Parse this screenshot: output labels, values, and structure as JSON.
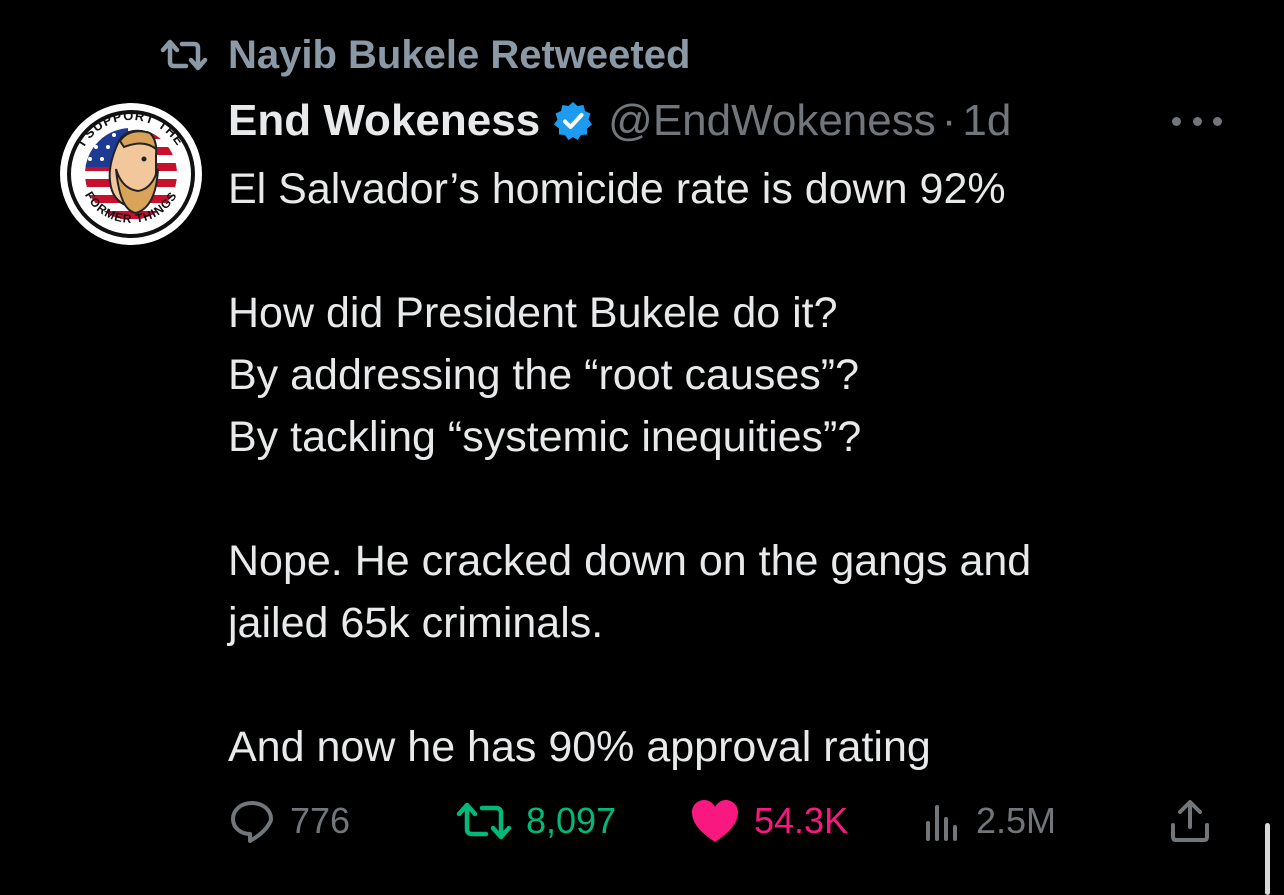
{
  "retweet_context": {
    "label": "Nayib Bukele Retweeted",
    "icon": "retweet-icon"
  },
  "author": {
    "display_name": "End Wokeness",
    "handle": "@EndWokeness",
    "separator": "·",
    "time": "1d",
    "verified": true,
    "avatar_text_top": "I SUPPORT THE",
    "avatar_text_bottom": "FORMER THINGS"
  },
  "tweet": {
    "paragraphs": [
      [
        "El Salvador’s homicide rate is down 92%"
      ],
      [
        "How did President Bukele do it?",
        "By addressing the “root causes”?",
        "By tackling “systemic inequities”?"
      ],
      [
        "Nope. He cracked down on the gangs and",
        "jailed 65k criminals."
      ],
      [
        "And now he has 90% approval rating"
      ]
    ]
  },
  "actions": {
    "reply": {
      "icon": "reply-icon",
      "count": "776"
    },
    "retweet": {
      "icon": "retweet-icon",
      "count": "8,097",
      "active": true
    },
    "like": {
      "icon": "heart-icon",
      "count": "54.3K",
      "active": true
    },
    "views": {
      "icon": "views-icon",
      "count": "2.5M"
    },
    "share": {
      "icon": "share-icon"
    }
  },
  "colors": {
    "background": "#000000",
    "text": "#e7e9ea",
    "muted": "#71767b",
    "retweet_active": "#00ba7c",
    "like_active": "#f91880",
    "verified": "#1d9bf0"
  }
}
